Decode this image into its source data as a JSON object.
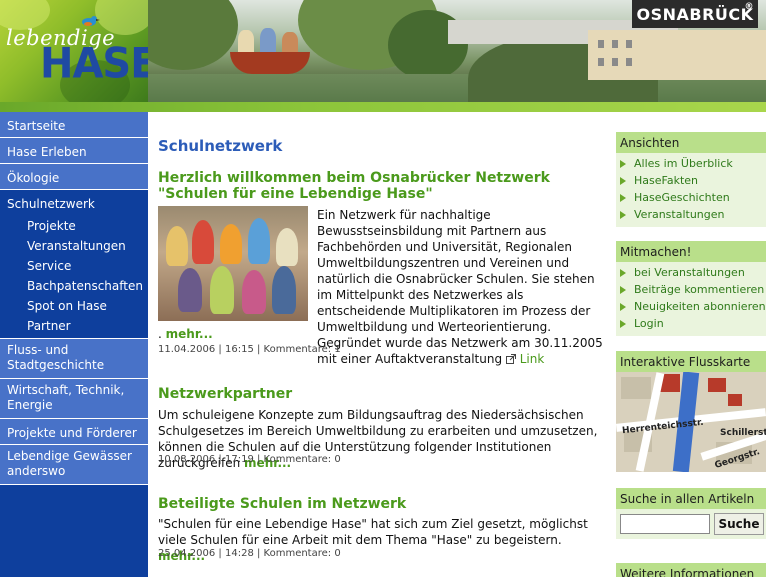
{
  "header": {
    "logo_top": "lebendige",
    "logo_bottom": "HASE",
    "city_badge": "OSNABRÜCK",
    "registered_mark": "®"
  },
  "sidebar": {
    "items": [
      {
        "label": "Startseite"
      },
      {
        "label": "Hase Erleben"
      },
      {
        "label": "Ökologie"
      },
      {
        "label": "Schulnetzwerk",
        "active": true
      },
      {
        "label": "Fluss- und Stadtgeschichte"
      },
      {
        "label": "Wirtschaft, Technik, Energie"
      },
      {
        "label": "Projekte und Förderer"
      },
      {
        "label": "Lebendige Gewässer anderswo"
      }
    ],
    "subitems": [
      {
        "label": "Projekte"
      },
      {
        "label": "Veranstaltungen"
      },
      {
        "label": "Service"
      },
      {
        "label": "Bachpatenschaften"
      },
      {
        "label": "Spot on Hase"
      },
      {
        "label": "Partner"
      }
    ]
  },
  "main": {
    "page_title": "Schulnetzwerk",
    "articles": [
      {
        "title": "Herzlich willkommen beim Osnabrücker Netzwerk \"Schulen für eine Lebendige Hase\"",
        "body": "Ein Netzwerk für nachhaltige Bewusstseinsbildung mit Partnern aus Fachbehörden und Universität, Regionalen Umweltbildungszentren und Vereinen und natürlich die Osnabrücker Schulen. Sie stehen im Mittelpunkt des Netzwerkes als entscheidende Multiplikatoren im Prozess der Umweltbildung und Werteorientierung. Gegründet wurde das Netzwerk am 30.11.2005 mit einer Auftaktveranstaltung",
        "link": "Link",
        "more_prefix": ".",
        "more": "mehr...",
        "meta": "11.04.2006 | 16:15 | Kommentare: 1"
      },
      {
        "title": "Netzwerkpartner",
        "body": "Um schuleigene Konzepte zum Bildungsauftrag des Niedersächsischen Schulgesetzes im Bereich Umweltbildung zu erarbeiten und umzusetzen, können die Schulen auf die Unterstützung folgender Institutionen zurückgreifen",
        "more": "mehr...",
        "meta": "10.08.2006 | 17:19 | Kommentare: 0"
      },
      {
        "title": "Beteiligte Schulen im Netzwerk",
        "body": "\"Schulen für eine Lebendige Hase\" hat sich zum Ziel gesetzt, möglichst viele Schulen für eine Arbeit mit dem Thema \"Hase\" zu begeistern.",
        "more": "mehr...",
        "meta": "25.04.2006 | 14:28 | Kommentare: 0"
      }
    ]
  },
  "right": {
    "ansichten": {
      "title": "Ansichten",
      "items": [
        "Alles im Überblick",
        "HaseFakten",
        "HaseGeschichten",
        "Veranstaltungen"
      ]
    },
    "mitmachen": {
      "title": "Mitmachen!",
      "items": [
        "bei Veranstaltungen",
        "Beiträge kommentieren",
        "Neuigkeiten abonnieren",
        "Login"
      ]
    },
    "map": {
      "title": "Interaktive Flusskarte",
      "labels": [
        "Herrenteichsstr.",
        "Schillerstr.",
        "Georgstr."
      ]
    },
    "search": {
      "title": "Suche in allen Artikeln",
      "placeholder": "",
      "button": "Suche"
    },
    "more_info": {
      "title": "Weitere Informationen"
    }
  },
  "colors": {
    "nav_blue": "#4872c8",
    "nav_dark": "#0e3f9d",
    "green_accent": "#4b9a1c",
    "title_blue": "#2c5cb8",
    "right_header": "#b9df8a"
  }
}
